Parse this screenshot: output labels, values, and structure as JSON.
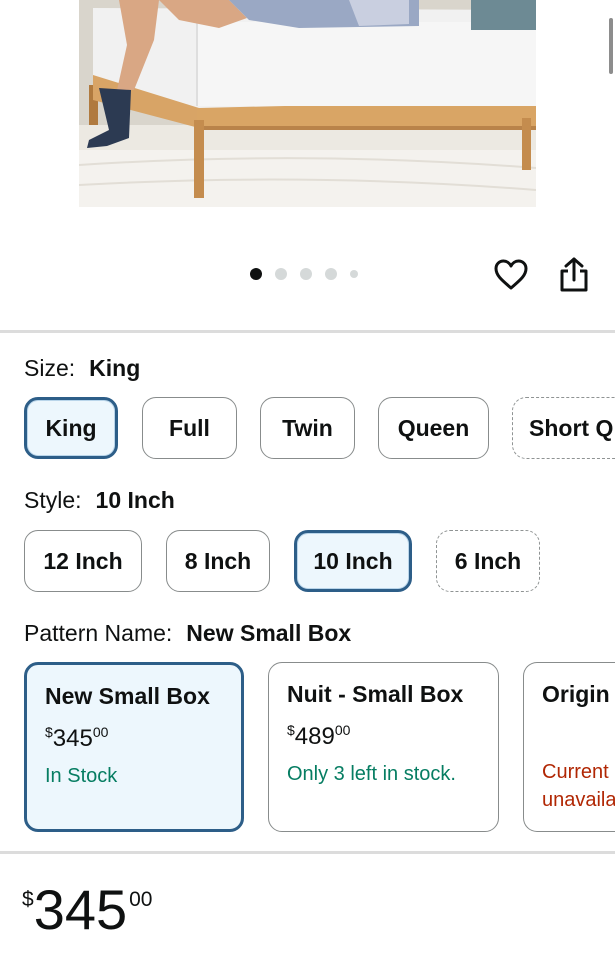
{
  "gallery": {
    "image_alt": "Bed frame with mattress",
    "dot_count": 5,
    "active_dot": 0,
    "actions": [
      "heart-icon",
      "share-icon"
    ]
  },
  "size": {
    "label": "Size:",
    "selected": "King",
    "options": [
      "King",
      "Full",
      "Twin",
      "Queen",
      "Short Q"
    ]
  },
  "style": {
    "label": "Style:",
    "selected": "10 Inch",
    "options": [
      "12 Inch",
      "8 Inch",
      "10 Inch",
      "6 Inch"
    ]
  },
  "pattern": {
    "label": "Pattern Name:",
    "selected": "New Small Box",
    "cards": [
      {
        "name": "New Small Box",
        "currency": "$",
        "whole": "345",
        "fraction": "00",
        "stock": "In Stock"
      },
      {
        "name": "Nuit - Small Box",
        "currency": "$",
        "whole": "489",
        "fraction": "00",
        "stock": "Only 3 left in stock."
      },
      {
        "name": "Origin",
        "stock": "Current unavaila"
      }
    ]
  },
  "price": {
    "currency": "$",
    "whole": "345",
    "fraction": "00"
  },
  "colors": {
    "selected_border": "#2d5e88",
    "selected_bg": "#edf7fd",
    "in_stock": "#067d62",
    "unavailable": "#b12704"
  }
}
